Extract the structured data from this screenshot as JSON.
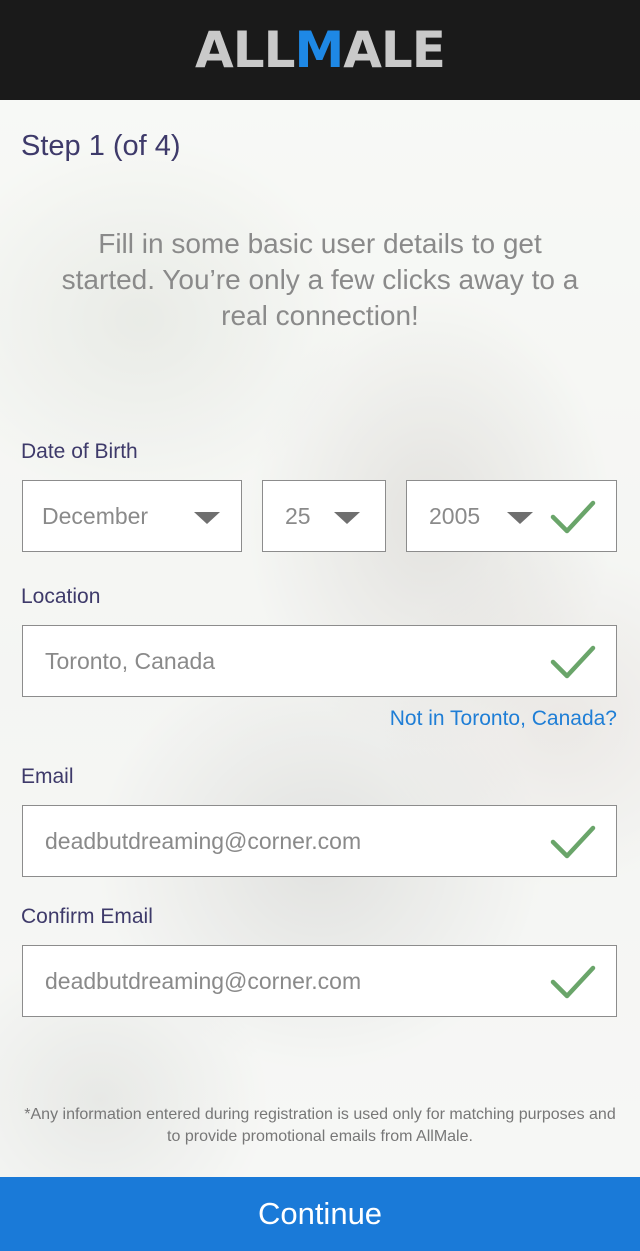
{
  "header": {
    "logo_part1": "ALL",
    "logo_part2": "M",
    "logo_part3": "ALE"
  },
  "step_title": "Step 1 (of 4)",
  "intro_text": "Fill in some basic user details to get started. You’re only a few clicks away to a real connection!",
  "dob": {
    "label": "Date of Birth",
    "month": "December",
    "day": "25",
    "year": "2005"
  },
  "location": {
    "label": "Location",
    "value": "Toronto, Canada",
    "change_link": "Not in Toronto, Canada?"
  },
  "email": {
    "label": "Email",
    "value": "deadbutdreaming@corner.com"
  },
  "confirm_email": {
    "label": "Confirm Email",
    "value": "deadbutdreaming@corner.com"
  },
  "disclaimer": "*Any information entered during registration is used only for matching purposes and to provide promotional emails from AllMale.",
  "continue_label": "Continue",
  "colors": {
    "brand_blue": "#1a7ad8",
    "check_green": "#6aa56a",
    "label_purple": "#3e3a6a"
  },
  "icons": {
    "dropdown": "chevron-down-icon",
    "valid": "check-icon"
  }
}
